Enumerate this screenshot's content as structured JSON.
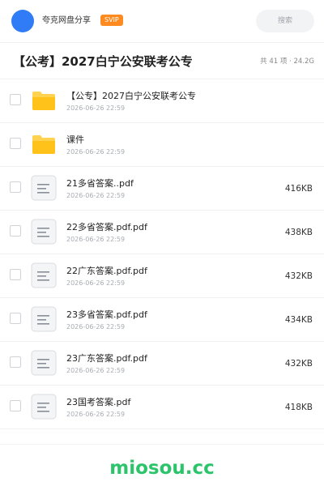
{
  "header": {
    "username": "夸克网盘分享",
    "badge": "SVIP",
    "search_placeholder": "搜索"
  },
  "title_bar": {
    "title": "【公考】2027白宁公安联考公专",
    "summary": "共 41 项 · 24.2G"
  },
  "files": [
    {
      "type": "folder",
      "name": "【公专】2027白宁公安联考公专",
      "date": "2026-06-26 22:59",
      "size": ""
    },
    {
      "type": "folder",
      "name": "课件",
      "date": "2026-06-26 22:59",
      "size": ""
    },
    {
      "type": "document",
      "name": "21多省答案..pdf",
      "date": "2026-06-26 22:59",
      "size": "416KB"
    },
    {
      "type": "document",
      "name": "22多省答案.pdf.pdf",
      "date": "2026-06-26 22:59",
      "size": "438KB"
    },
    {
      "type": "document",
      "name": "22广东答案.pdf.pdf",
      "date": "2026-06-26 22:59",
      "size": "432KB"
    },
    {
      "type": "document",
      "name": "23多省答案.pdf.pdf",
      "date": "2026-06-26 22:59",
      "size": "434KB"
    },
    {
      "type": "document",
      "name": "23广东答案.pdf.pdf",
      "date": "2026-06-26 22:59",
      "size": "432KB"
    },
    {
      "type": "document",
      "name": "23国考答案.pdf",
      "date": "2026-06-26 22:59",
      "size": "418KB"
    }
  ],
  "footer": {
    "brand": "miosou.cc"
  },
  "colors": {
    "avatar": "#2f7cf6",
    "badge": "#ff8a1f",
    "folder": "#ffc533",
    "brand": "#2cc46a"
  },
  "icons": {
    "folder": "folder-icon",
    "document": "document-icon"
  }
}
